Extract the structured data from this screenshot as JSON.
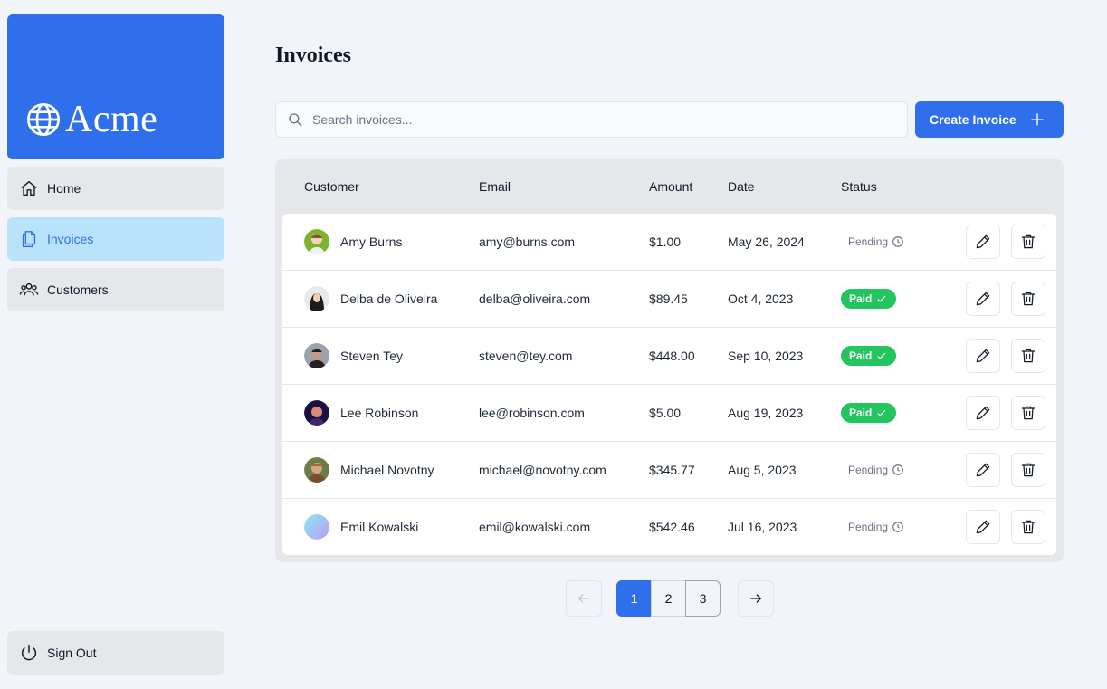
{
  "brand": {
    "name": "Acme",
    "color": "#2f6feb"
  },
  "sidebar": {
    "items": [
      {
        "label": "Home",
        "icon": "home-icon",
        "active": false
      },
      {
        "label": "Invoices",
        "icon": "document-icon",
        "active": true
      },
      {
        "label": "Customers",
        "icon": "users-icon",
        "active": false
      }
    ],
    "signout_label": "Sign Out"
  },
  "page": {
    "title": "Invoices"
  },
  "search": {
    "placeholder": "Search invoices..."
  },
  "toolbar": {
    "create_label": "Create Invoice"
  },
  "table": {
    "headers": {
      "customer": "Customer",
      "email": "Email",
      "amount": "Amount",
      "date": "Date",
      "status": "Status"
    },
    "rows": [
      {
        "name": "Amy Burns",
        "email": "amy@burns.com",
        "amount": "$1.00",
        "date": "May 26, 2024",
        "status": "Pending"
      },
      {
        "name": "Delba de Oliveira",
        "email": "delba@oliveira.com",
        "amount": "$89.45",
        "date": "Oct 4, 2023",
        "status": "Paid"
      },
      {
        "name": "Steven Tey",
        "email": "steven@tey.com",
        "amount": "$448.00",
        "date": "Sep 10, 2023",
        "status": "Paid"
      },
      {
        "name": "Lee Robinson",
        "email": "lee@robinson.com",
        "amount": "$5.00",
        "date": "Aug 19, 2023",
        "status": "Paid"
      },
      {
        "name": "Michael Novotny",
        "email": "michael@novotny.com",
        "amount": "$345.77",
        "date": "Aug 5, 2023",
        "status": "Pending"
      },
      {
        "name": "Emil Kowalski",
        "email": "emil@kowalski.com",
        "amount": "$542.46",
        "date": "Jul 16, 2023",
        "status": "Pending"
      }
    ]
  },
  "pagination": {
    "pages": [
      "1",
      "2",
      "3"
    ],
    "current": "1"
  },
  "colors": {
    "paid": "#22c55e",
    "pending": "#6b7280",
    "active_nav_bg": "#b9e2fb"
  }
}
